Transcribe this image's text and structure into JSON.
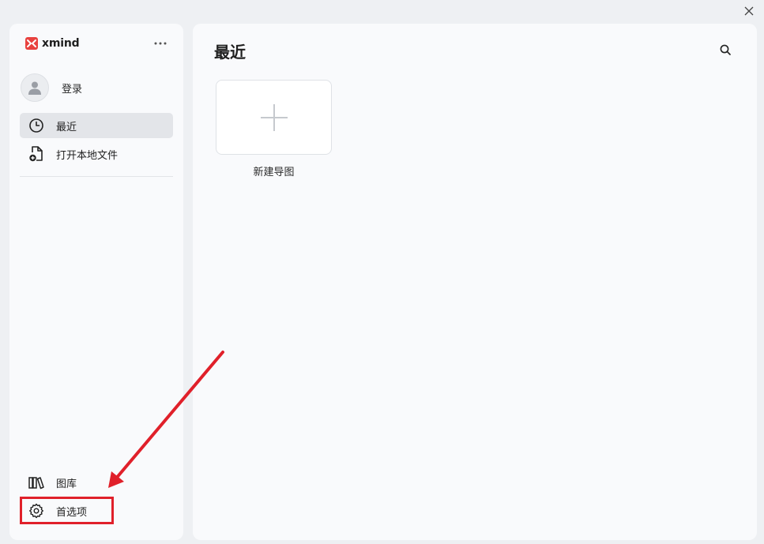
{
  "window": {
    "close_icon": "close-icon"
  },
  "sidebar": {
    "logo_text": "xmind",
    "more_icon": "more-horizontal-icon",
    "user": {
      "label": "登录",
      "icon": "user-avatar-icon"
    },
    "nav": [
      {
        "label": "最近",
        "icon": "clock-icon",
        "active": true
      },
      {
        "label": "打开本地文件",
        "icon": "file-add-icon",
        "active": false
      }
    ],
    "bottom": [
      {
        "label": "图库",
        "icon": "library-icon"
      },
      {
        "label": "首选项",
        "icon": "gear-icon"
      }
    ]
  },
  "main": {
    "title": "最近",
    "search_icon": "search-icon",
    "new_card": {
      "label": "新建导图",
      "icon": "plus-icon"
    }
  },
  "colors": {
    "brand": "#e8423f",
    "annotation": "#e0202a",
    "active_bg": "#e3e5e9"
  }
}
